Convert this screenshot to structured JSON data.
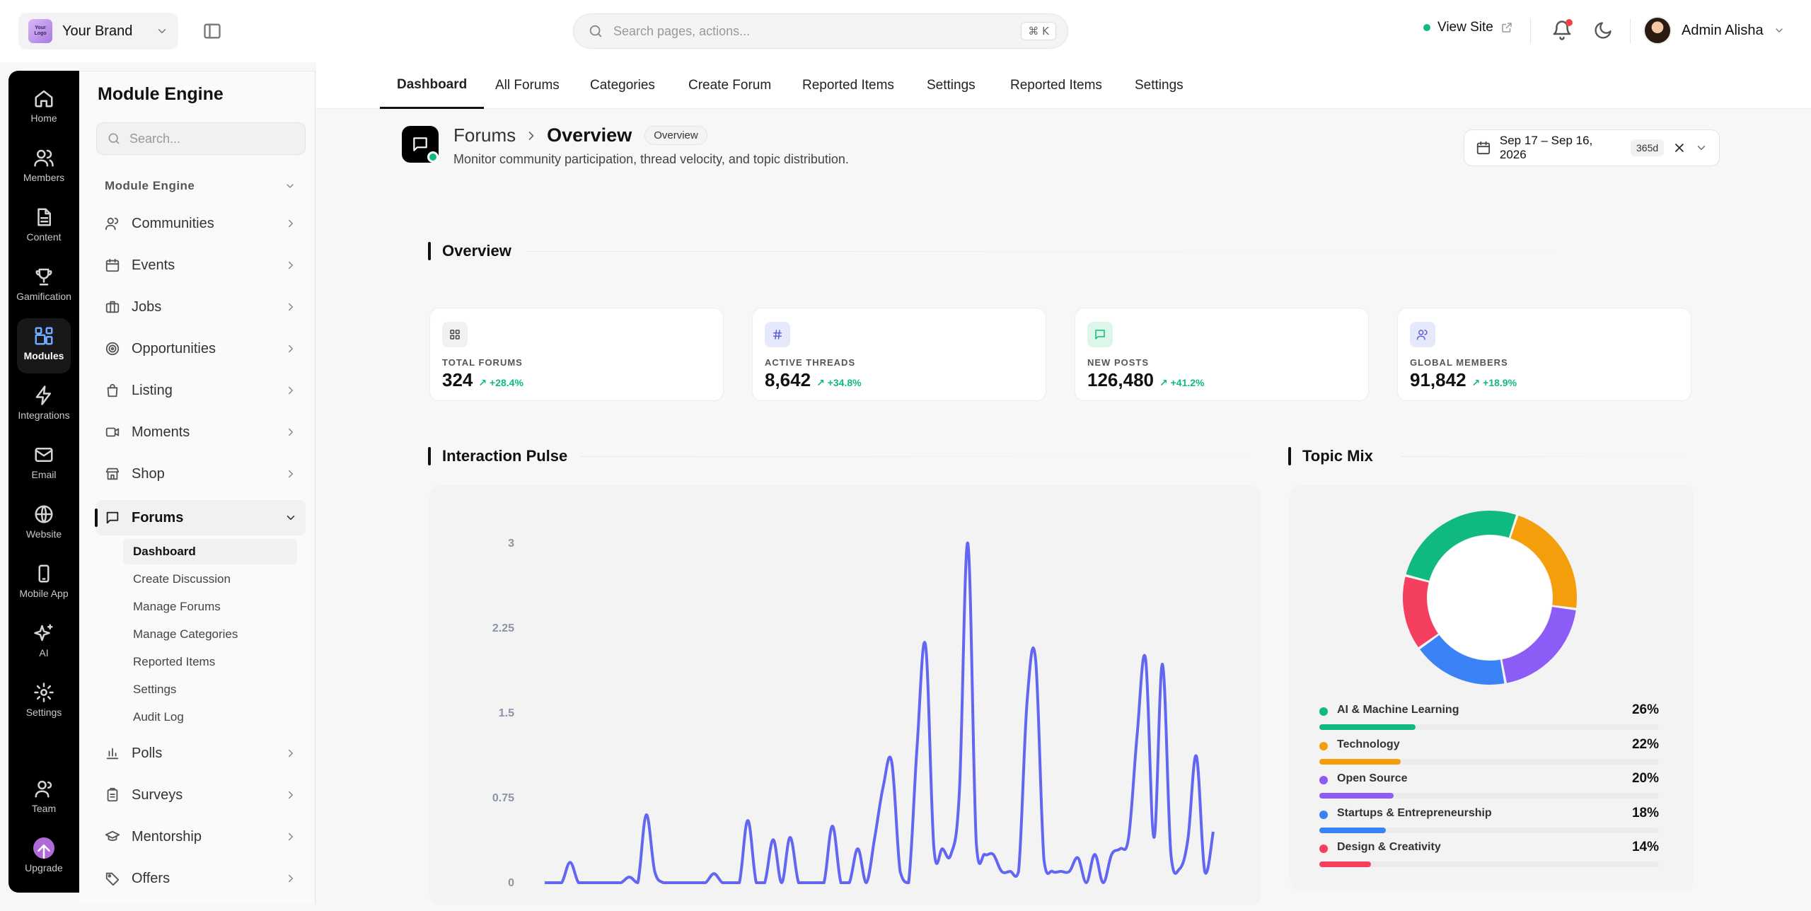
{
  "header": {
    "brand_logo_text": "Your Logo",
    "brand_name": "Your Brand",
    "search_placeholder": "Search pages, actions...",
    "search_shortcut": "⌘ K",
    "view_site": "View Site",
    "user_name": "Admin Alisha"
  },
  "rail": {
    "items": [
      {
        "label": "Home",
        "icon": "home-icon"
      },
      {
        "label": "Members",
        "icon": "users-icon"
      },
      {
        "label": "Content",
        "icon": "document-icon"
      },
      {
        "label": "Gamification",
        "icon": "trophy-icon"
      },
      {
        "label": "Modules",
        "icon": "modules-icon"
      },
      {
        "label": "Integrations",
        "icon": "bolt-icon"
      },
      {
        "label": "Email",
        "icon": "mail-icon"
      },
      {
        "label": "Website",
        "icon": "globe-icon"
      },
      {
        "label": "Mobile App",
        "icon": "phone-icon"
      },
      {
        "label": "AI",
        "icon": "sparkles-icon"
      },
      {
        "label": "Settings",
        "icon": "gear-icon"
      },
      {
        "label": "Team",
        "icon": "team-icon"
      },
      {
        "label": "Upgrade",
        "icon": "upgrade-icon"
      }
    ]
  },
  "panel": {
    "title": "Module Engine",
    "search_placeholder": "Search...",
    "group_label": "Module Engine",
    "items": [
      {
        "label": "Communities"
      },
      {
        "label": "Events"
      },
      {
        "label": "Jobs"
      },
      {
        "label": "Opportunities"
      },
      {
        "label": "Listing"
      },
      {
        "label": "Moments"
      },
      {
        "label": "Shop"
      },
      {
        "label": "Forums"
      },
      {
        "label": "Polls"
      },
      {
        "label": "Surveys"
      },
      {
        "label": "Mentorship"
      },
      {
        "label": "Offers"
      }
    ],
    "forum_sub": [
      "Dashboard",
      "Create Discussion",
      "Manage Forums",
      "Manage Categories",
      "Reported Items",
      "Settings",
      "Audit Log"
    ]
  },
  "tabs": [
    "Dashboard",
    "All Forums",
    "Categories",
    "Create Forum",
    "Reported Items",
    "Settings",
    "Reported Items",
    "Settings"
  ],
  "page": {
    "crumb_parent": "Forums",
    "crumb_current": "Overview",
    "badge": "Overview",
    "subtitle": "Monitor community participation, thread velocity, and topic distribution.",
    "date_range": "Sep 17 – Sep 16, 2026",
    "date_span": "365d"
  },
  "overview": {
    "title": "Overview",
    "stats": [
      {
        "label": "TOTAL FORUMS",
        "value": "324",
        "delta": "+28.4%",
        "icon": "grid-icon",
        "color": "#f1f1f3",
        "icon_color": "#444"
      },
      {
        "label": "ACTIVE THREADS",
        "value": "8,642",
        "delta": "+34.8%",
        "icon": "hash-icon",
        "color": "#e6e8fb",
        "icon_color": "#5b5fd6"
      },
      {
        "label": "NEW POSTS",
        "value": "126,480",
        "delta": "+41.2%",
        "icon": "message-icon",
        "color": "#dcf7ea",
        "icon_color": "#10b981"
      },
      {
        "label": "GLOBAL MEMBERS",
        "value": "91,842",
        "delta": "+18.9%",
        "icon": "members-icon",
        "color": "#e6e8fb",
        "icon_color": "#5b5fd6"
      }
    ]
  },
  "pulse": {
    "title": "Interaction Pulse"
  },
  "mix": {
    "title": "Topic Mix"
  },
  "chart_data": [
    {
      "type": "line",
      "title": "Interaction Pulse",
      "ylim": [
        0,
        3
      ],
      "yticks": [
        "0",
        "0.75",
        "1.5",
        "2.25",
        "3"
      ],
      "color": "#6366f1",
      "x": [
        0,
        1,
        2,
        3,
        4,
        5,
        6,
        7,
        8,
        9,
        10,
        11,
        12,
        13,
        14,
        15,
        16,
        17,
        18,
        19,
        20,
        21,
        22,
        23,
        24,
        25,
        26,
        27,
        28,
        29,
        30,
        31,
        32,
        33,
        34,
        35,
        36,
        37,
        38,
        39,
        40,
        41,
        42,
        43,
        44,
        45,
        46,
        47,
        48,
        49,
        50,
        51,
        52,
        53,
        54,
        55,
        56,
        57,
        58,
        59,
        60,
        61,
        62,
        63,
        64,
        65,
        66,
        67,
        68,
        69,
        70,
        71,
        72,
        73,
        74,
        75,
        76,
        77,
        78,
        79
      ],
      "values": [
        0,
        0,
        0,
        0.18,
        0,
        0,
        0,
        0,
        0,
        0,
        0.05,
        0,
        0.6,
        0.1,
        0,
        0,
        0,
        0,
        0,
        0,
        0.08,
        0,
        0,
        0,
        0.55,
        0,
        0,
        0.38,
        0,
        0.4,
        0,
        0,
        0,
        0,
        0.5,
        0,
        0,
        0.3,
        0,
        0.4,
        0.85,
        1.07,
        0.1,
        0,
        1.2,
        2.1,
        0.3,
        0.3,
        0.25,
        0.8,
        3.0,
        0.35,
        0.25,
        0.25,
        0.1,
        0.1,
        0.1,
        1.6,
        1.98,
        0.2,
        0.1,
        0.1,
        0.1,
        0.22,
        0,
        0.25,
        0,
        0.25,
        0.3,
        0.4,
        1.3,
        1.98,
        0.4,
        1.93,
        0.25,
        0.12,
        0.38,
        1.12,
        0.1,
        0.45
      ]
    },
    {
      "type": "pie",
      "title": "Topic Mix",
      "categories": [
        "AI & Machine Learning",
        "Technology",
        "Open Source",
        "Startups & Entrepreneurship",
        "Design & Creativity"
      ],
      "values": [
        26,
        22,
        20,
        18,
        14
      ],
      "colors": [
        "#10b981",
        "#f59e0b",
        "#8b5cf6",
        "#3b82f6",
        "#f43f5e"
      ],
      "labels": [
        "26%",
        "22%",
        "20%",
        "18%",
        "14%"
      ]
    }
  ]
}
